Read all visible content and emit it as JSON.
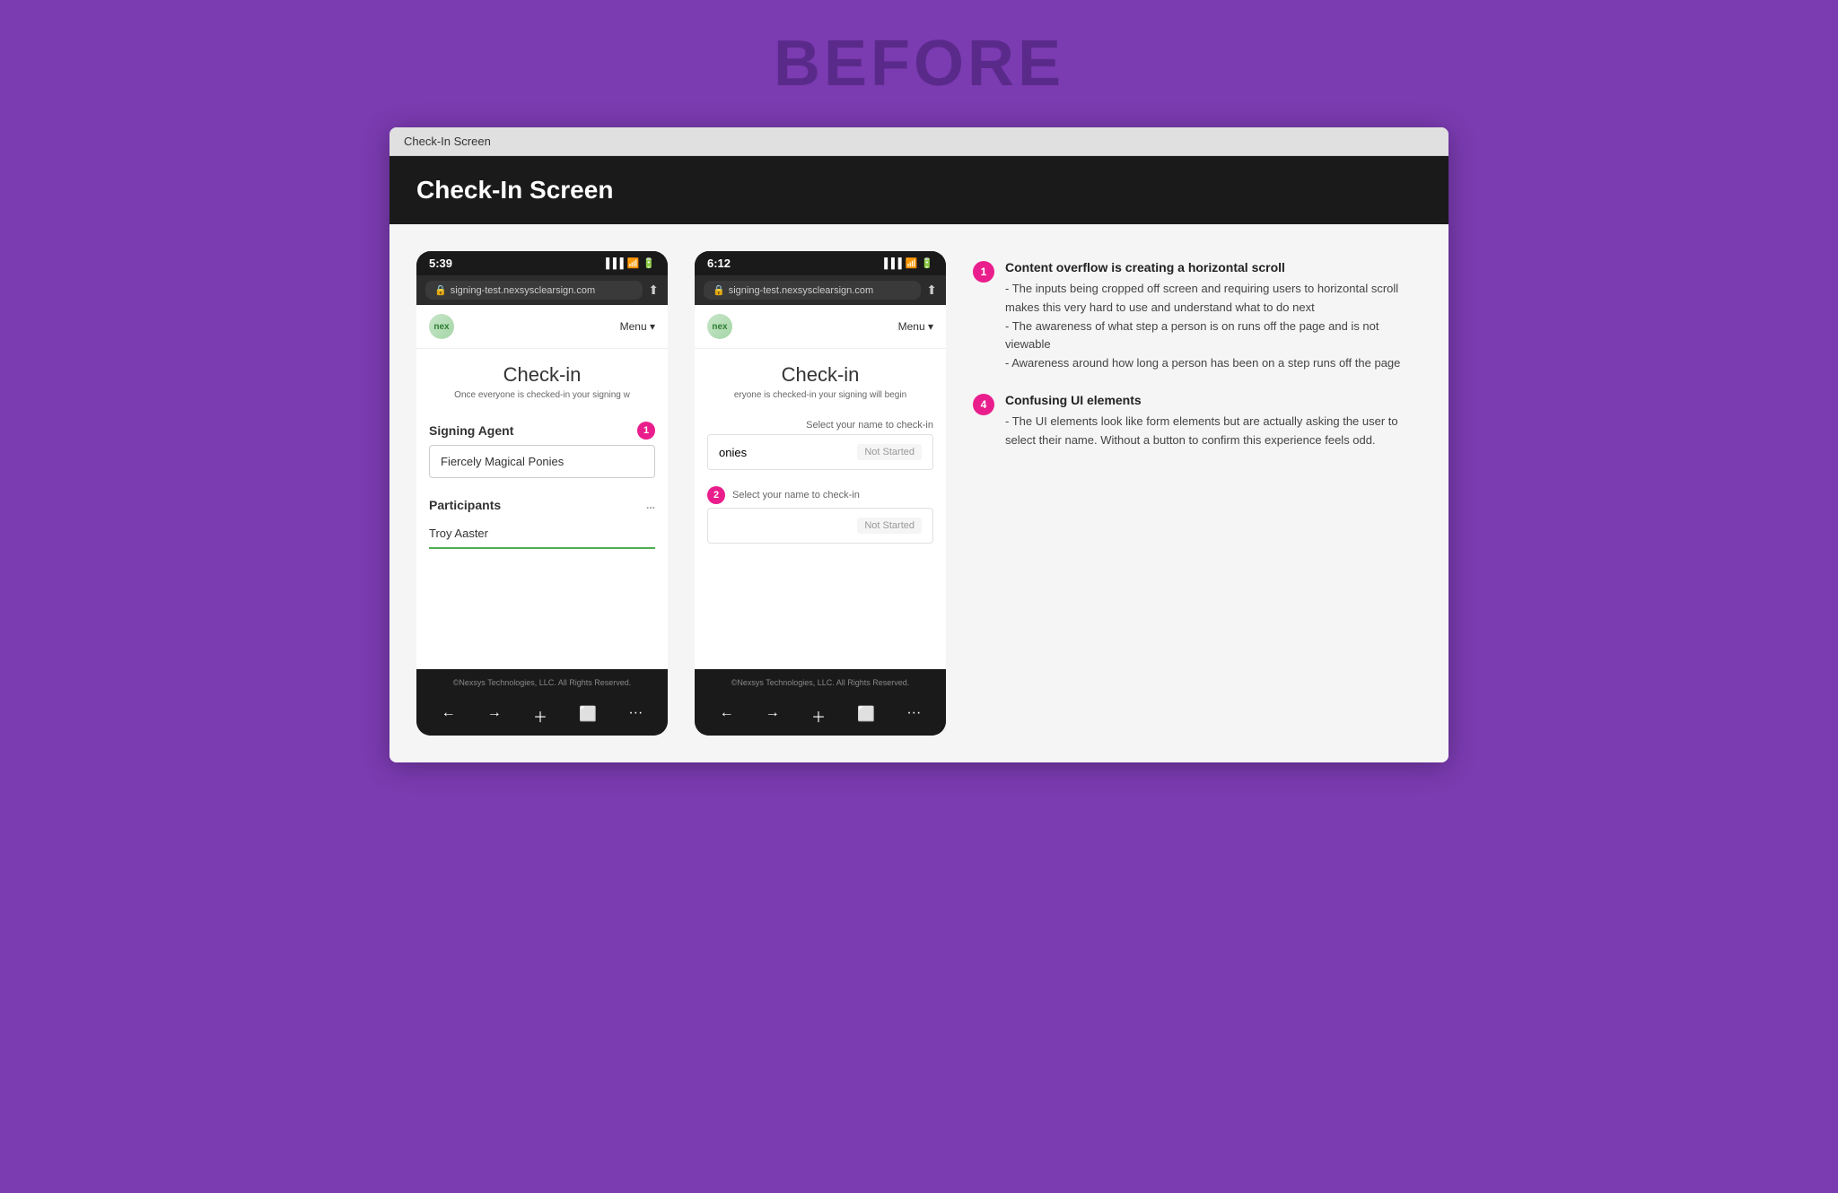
{
  "page": {
    "before_title": "BEFORE",
    "window_title": "Check-In Screen",
    "header_title": "Check-In Screen"
  },
  "phone_left": {
    "time": "5:39",
    "url": "signing-test.nexsysclearsign.com",
    "logo": "nex",
    "menu": "Menu ▾",
    "checkin_title": "Check-in",
    "checkin_sub": "Once everyone is checked-in your signing w",
    "signing_agent_label": "Signing Agent",
    "signing_agent_value": "Fiercely Magical Ponies",
    "participants_label": "Participants",
    "participants_value": "Troy Aaster",
    "footer": "©Nexsys Technologies, LLC. All Rights Reserved."
  },
  "phone_right": {
    "time": "6:12",
    "url": "signing-test.nexsysclearsign.com",
    "logo": "nex",
    "menu": "Menu ▾",
    "checkin_title": "Check-in",
    "checkin_sub": "eryone is checked-in your signing will begin",
    "select_label": "Select your name to check-in",
    "agent_value": "onies",
    "agent_status": "Not Started",
    "badge2_label": "Select your name to check-in",
    "participant_status": "Not Started",
    "footer": "©Nexsys Technologies, LLC. All Rights Reserved."
  },
  "notes": [
    {
      "number": "1",
      "title": "Content overflow is creating a horizontal scroll",
      "body": "- The inputs being cropped off screen and requiring users to horizontal scroll makes this very hard to use and understand what to do next\n- The awareness of what step a person is on runs off the page and is not viewable\n- Awareness around how long a person has been on a step runs off the page"
    },
    {
      "number": "4",
      "title": "Confusing UI elements",
      "body": "- The UI elements look like form elements but are actually asking the user to select their name. Without a button to confirm this experience feels odd."
    }
  ]
}
